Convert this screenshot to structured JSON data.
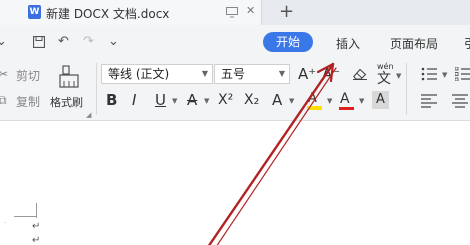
{
  "titlebar": {
    "doc_icon_letter": "W",
    "doc_title": "新建 DOCX 文档.docx",
    "close_glyph": "✕",
    "new_tab_glyph": "+"
  },
  "quick_access": [
    "⊞",
    "↶",
    "↷",
    "⌄"
  ],
  "ribbon_tabs": {
    "active": "开始",
    "tabs": [
      "插入",
      "页面布局",
      "引"
    ]
  },
  "clipboard": {
    "cut_label": "剪切",
    "copy_label": "复制",
    "format_painter_label": "格式刷"
  },
  "font": {
    "family": "等线 (正文)",
    "size": "五号",
    "grow": "A⁺",
    "shrink": "A⁻",
    "clear": "⌫",
    "phonetic_top": "wén",
    "phonetic": "文",
    "bold": "B",
    "italic": "I",
    "underline": "U",
    "strike": "A",
    "superscript": "X²",
    "subscript": "X₂",
    "text_effect": "A",
    "highlight": "A",
    "font_color": "A",
    "shade": "A"
  },
  "colors": {
    "accent": "#3b78e7",
    "arrow": "#b22222",
    "font_color_bar": "#e02020",
    "highlight_bar": "#ffe000"
  },
  "document": {
    "paragraph_mark": "↵"
  }
}
